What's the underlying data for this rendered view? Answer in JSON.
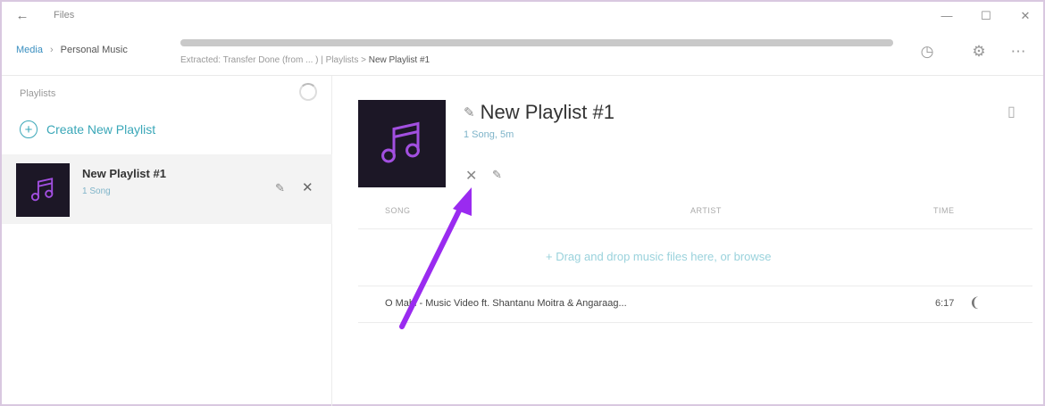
{
  "window": {
    "title": "Files",
    "controls": {
      "minimize": "—",
      "maximize": "☐",
      "close": "✕"
    }
  },
  "header": {
    "breadcrumb": [
      "Media",
      "›",
      "Personal Music"
    ],
    "progress": 1.0,
    "status_prefix": "Extracted: Transfer Done (from ... ) | Playlists > ",
    "status_current": "New Playlist #1",
    "icons": [
      "history-icon",
      "settings-icon",
      "more-icon"
    ]
  },
  "sidebar": {
    "header": "Playlists",
    "create_label": "Create New Playlist",
    "items": [
      {
        "title": "New Playlist #1",
        "subtitle": "1 Song"
      }
    ]
  },
  "main": {
    "title": "New Playlist #1",
    "meta": "1 Song, 5m",
    "columns": {
      "song": "SONG",
      "artist": "ARTIST",
      "time": "TIME"
    },
    "drop_hint": "+   Drag and drop music files here, or browse",
    "songs": [
      {
        "title": "O Mahi - Music Video ft. Shantanu Moitra & Angaraag...",
        "time": "6:17"
      }
    ]
  },
  "colors": {
    "accent": "#3aa7b8",
    "arrow": "#9a2bf0",
    "thumb_bg": "#1c1726",
    "thumb_note": "#a24fe0"
  }
}
